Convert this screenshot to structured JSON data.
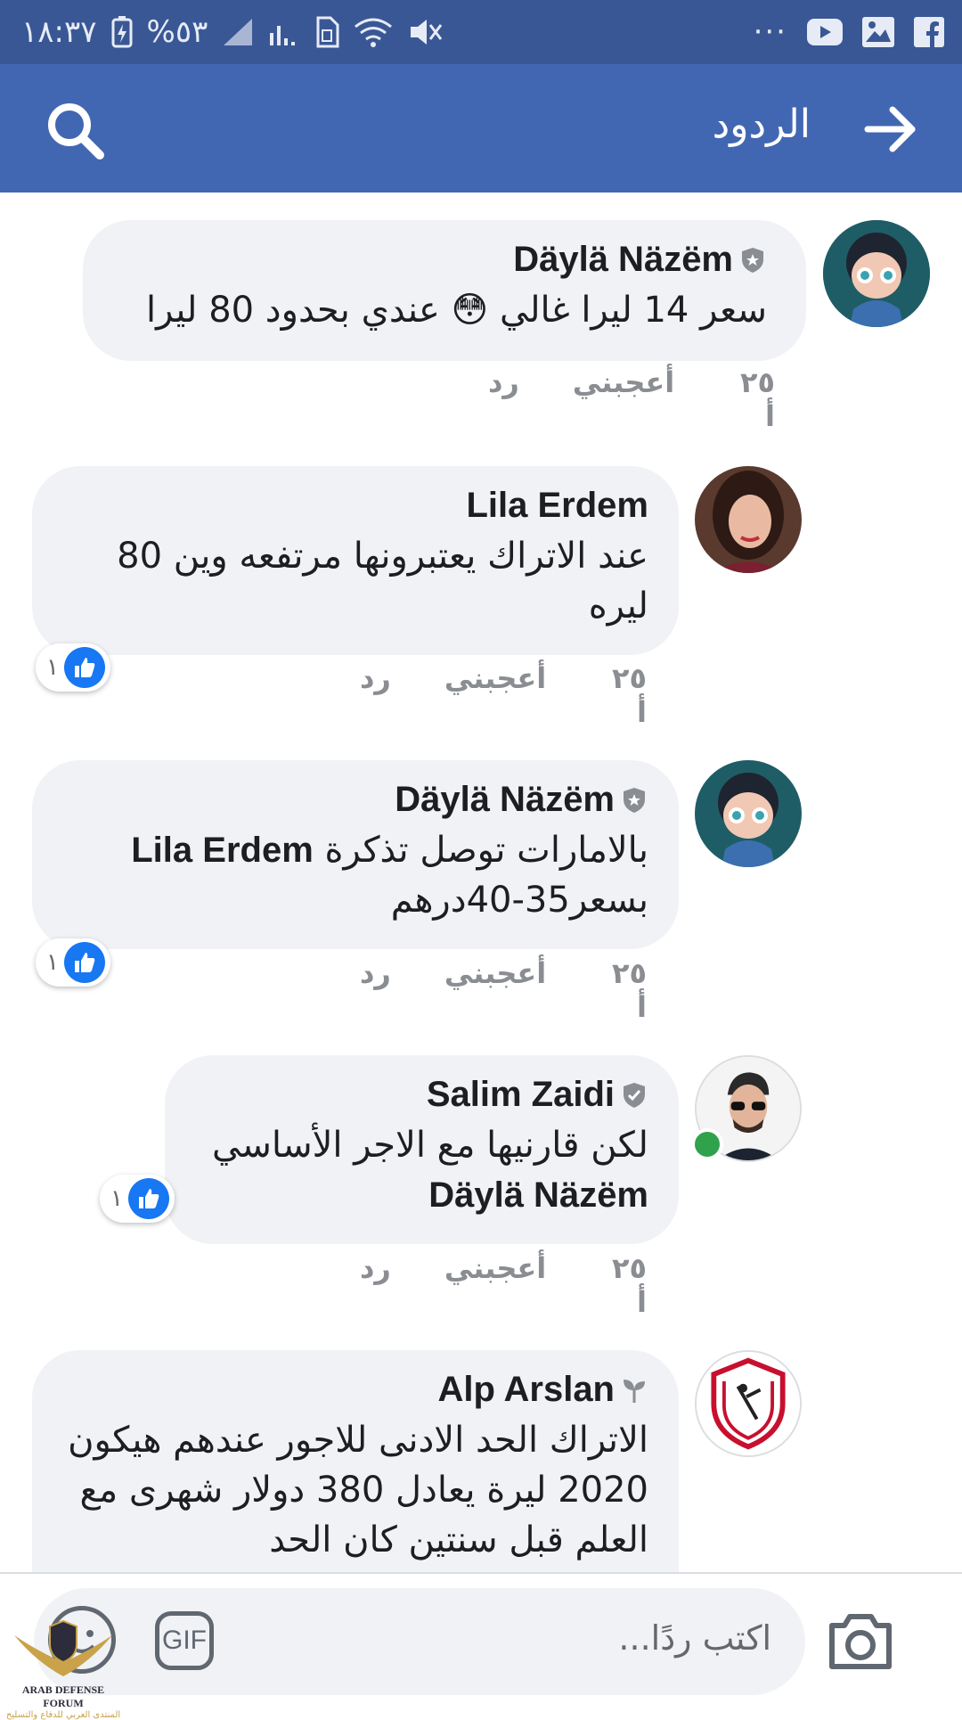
{
  "status_bar": {
    "time": "١٨:٣٧",
    "battery": "%٥٣"
  },
  "toolbar": {
    "title": "الردود"
  },
  "comments": [
    {
      "author": "Däylä Näzëm",
      "text": "سعر 14 ليرا غالي 😳 عندي بحدود 80 ليرا",
      "time": "٢٥ أ",
      "like_label": "أعجبني",
      "reply_label": "رد"
    },
    {
      "author": "Lila Erdem",
      "text": "عند الاتراك يعتبرونها مرتفعه وين 80 ليره",
      "time": "٢٥ أ",
      "like_label": "أعجبني",
      "reply_label": "رد",
      "reactions": "١"
    },
    {
      "author": "Däylä Näzëm",
      "mention": "Lila Erdem",
      "text": "بالامارات توصل تذكرة",
      "text2": "بسعر35-40درهم",
      "time": "٢٥ أ",
      "like_label": "أعجبني",
      "reply_label": "رد",
      "reactions": "١"
    },
    {
      "author": "Salim Zaidi",
      "text": "لكن قارنيها مع الاجر الأساسي",
      "mention": "Däylä Näzëm",
      "time": "٢٥ أ",
      "like_label": "أعجبني",
      "reply_label": "رد",
      "reactions": "١"
    },
    {
      "author": "Alp Arslan",
      "text": "الاتراك الحد الادنى للاجور عندهم هيكون 2020 ليرة يعادل  380 دولار شهرى مع العلم قبل سنتين كان الحد"
    }
  ],
  "composer": {
    "placeholder": "اكتب ردًا...",
    "gif_label": "GIF"
  },
  "watermark": {
    "text": "ARAB DEFENSE FORUM",
    "text_ar": "المنتدى العربي للدفاع والتسليح"
  },
  "colors": {
    "status_bar": "#3a5795",
    "toolbar": "#4267b2",
    "bubble": "#f0f2f5",
    "like_blue": "#1877f2",
    "online_green": "#31a24c"
  }
}
